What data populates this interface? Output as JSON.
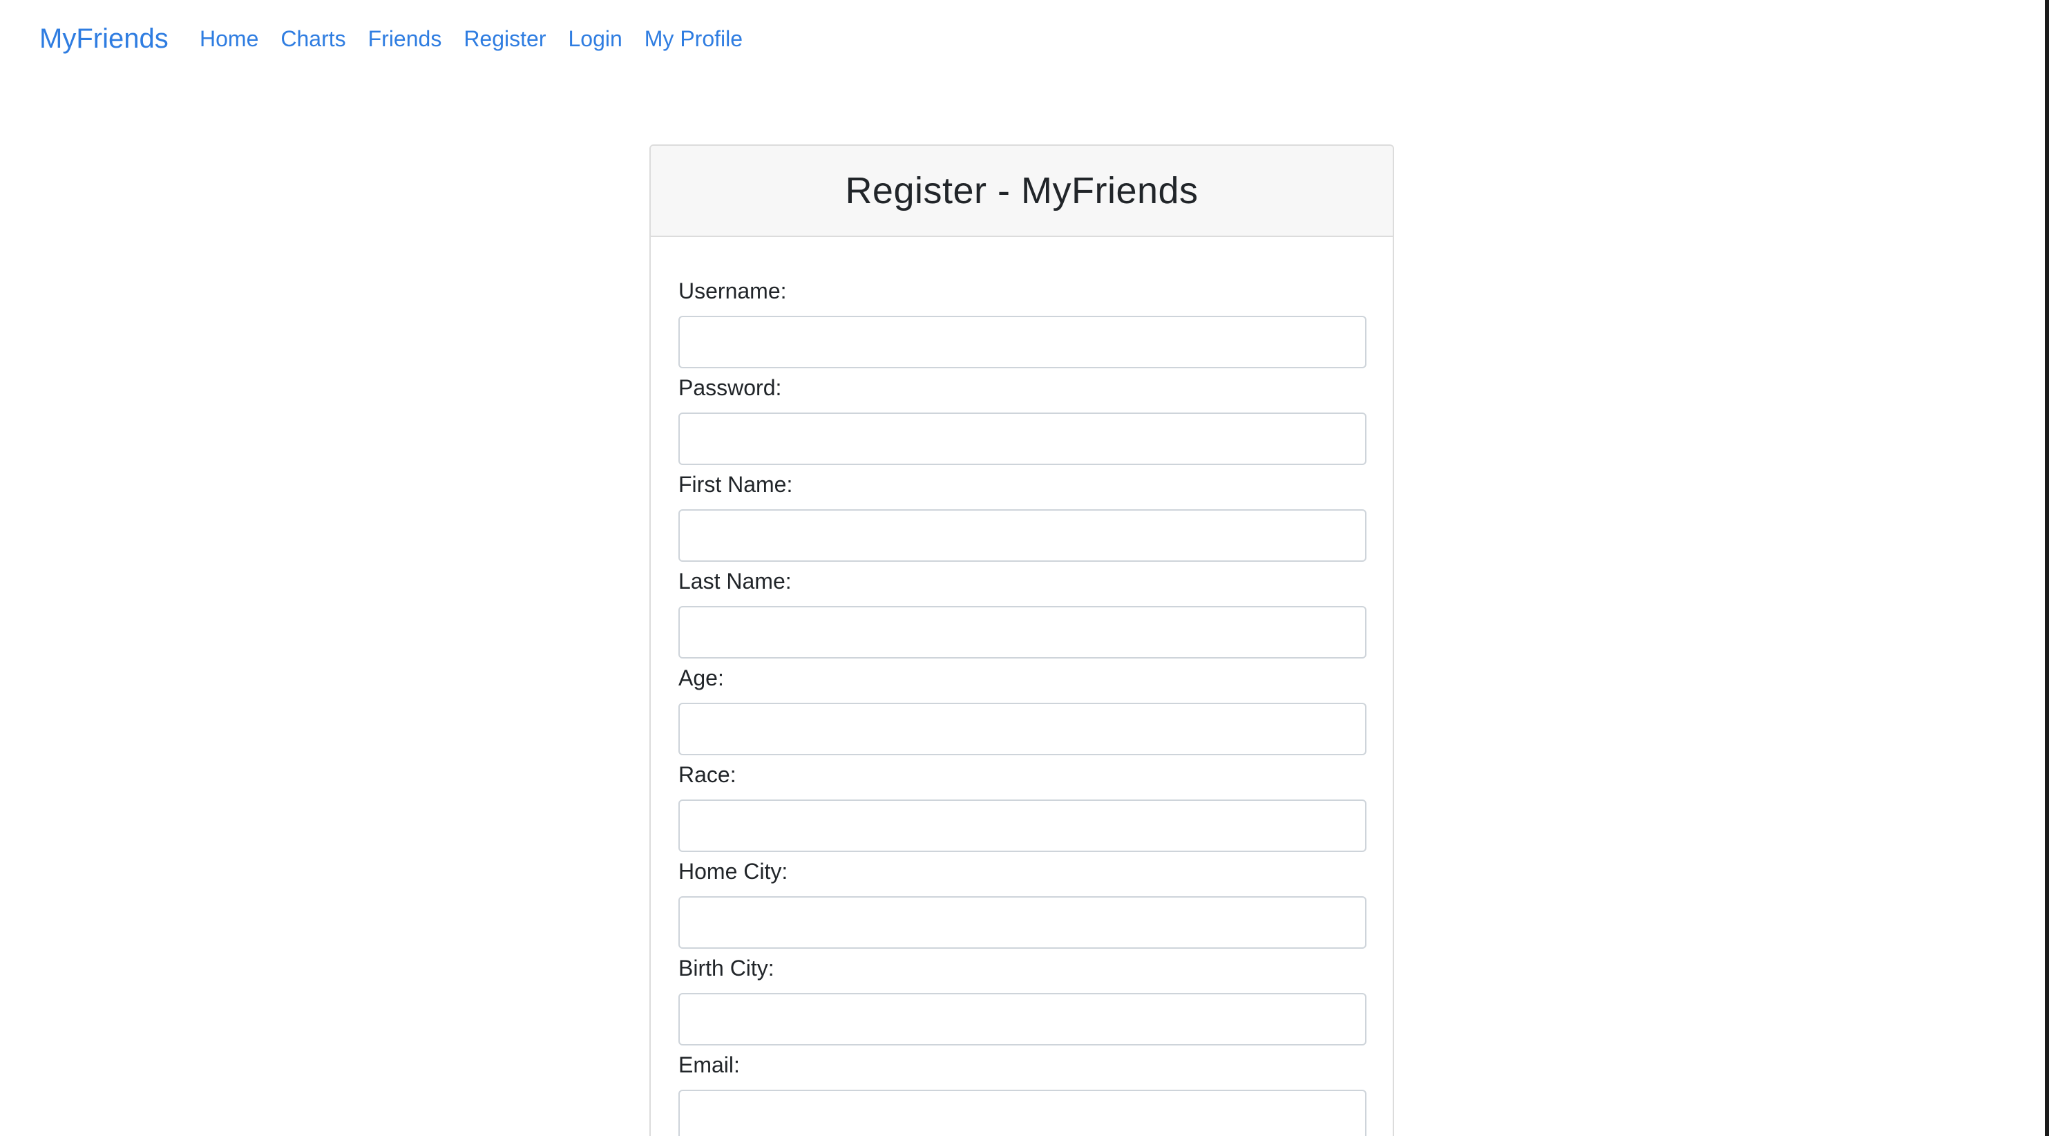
{
  "navbar": {
    "brand": "MyFriends",
    "links": [
      {
        "label": "Home"
      },
      {
        "label": "Charts"
      },
      {
        "label": "Friends"
      },
      {
        "label": "Register"
      },
      {
        "label": "Login"
      },
      {
        "label": "My Profile"
      }
    ]
  },
  "form": {
    "title": "Register - MyFriends",
    "fields": [
      {
        "label": "Username:",
        "value": ""
      },
      {
        "label": "Password:",
        "value": ""
      },
      {
        "label": "First Name:",
        "value": ""
      },
      {
        "label": "Last Name:",
        "value": ""
      },
      {
        "label": "Age:",
        "value": ""
      },
      {
        "label": "Race:",
        "value": ""
      },
      {
        "label": "Home City:",
        "value": ""
      },
      {
        "label": "Birth City:",
        "value": ""
      },
      {
        "label": "Email:",
        "value": ""
      }
    ]
  },
  "colors": {
    "link": "#2f7de1",
    "text": "#212529",
    "header_bg": "#f7f7f7",
    "border": "#dcdcdc"
  }
}
